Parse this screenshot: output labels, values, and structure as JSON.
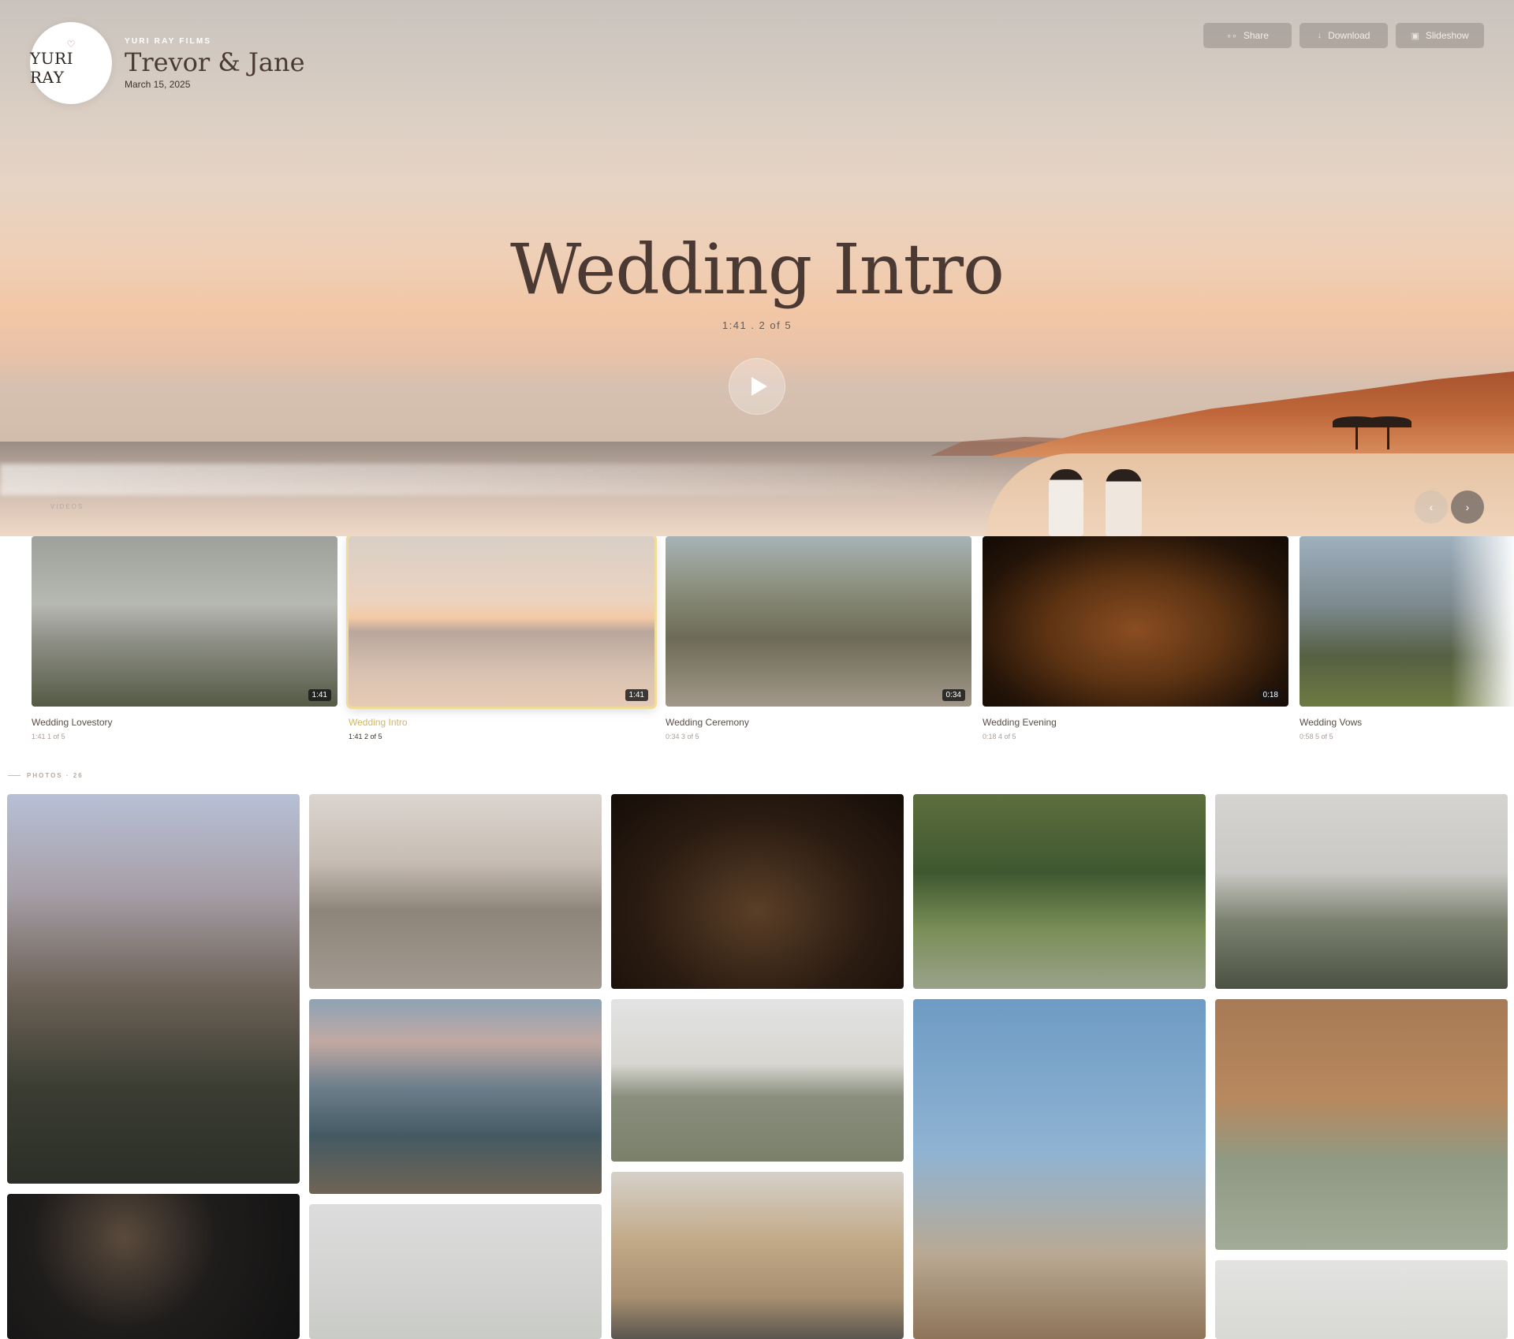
{
  "brand": {
    "logo_mark": "♡",
    "logo_text": "YURI RAY",
    "kicker": "YURI RAY FILMS",
    "couple": "Trevor & Jane",
    "date": "March 15, 2025"
  },
  "toolbar": {
    "share_label": "Share",
    "download_label": "Download",
    "slideshow_label": "Slideshow"
  },
  "hero": {
    "title": "Wedding Intro",
    "meta": "1:41 . 2 of 5"
  },
  "videos": {
    "label": "VIDEOS",
    "items": [
      {
        "title": "Wedding Lovestory",
        "sub": "1:41  1 of 5",
        "duration": "1:41"
      },
      {
        "title": "Wedding Intro",
        "sub": "1:41  2 of 5",
        "duration": "1:41"
      },
      {
        "title": "Wedding Ceremony",
        "sub": "0:34  3 of 5",
        "duration": "0:34"
      },
      {
        "title": "Wedding Evening",
        "sub": "0:18  4 of 5",
        "duration": "0:18"
      },
      {
        "title": "Wedding Vows",
        "sub": "0:58  5 of 5",
        "duration": ""
      }
    ]
  },
  "photos": {
    "label": "PHOTOS · 26"
  },
  "icons": {
    "share": "share-icon",
    "download": "download-icon",
    "slideshow": "slideshow-icon",
    "play": "play-icon",
    "prev": "chevron-left-icon",
    "next": "chevron-right-icon"
  },
  "colors": {
    "accent": "#d1b663",
    "active_border": "#f0dc9a",
    "title_text": "#4b3a33"
  }
}
